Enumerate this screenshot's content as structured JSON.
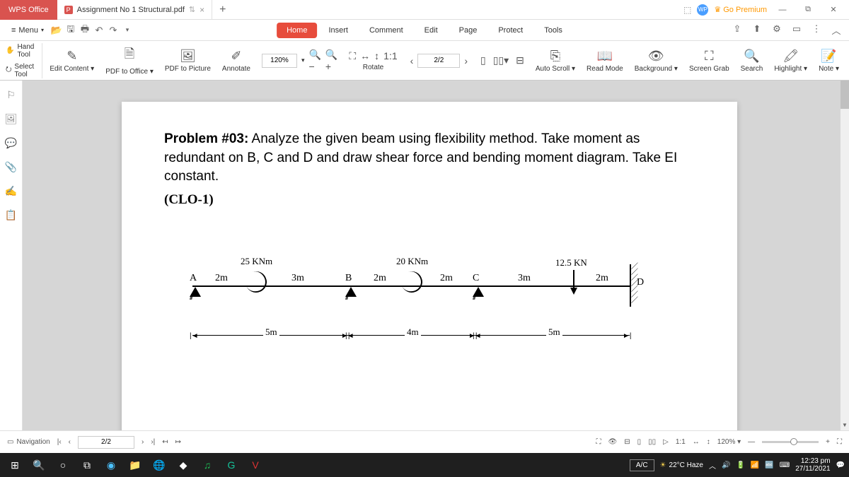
{
  "titlebar": {
    "app_name": "WPS Office",
    "tab_title": "Assignment No 1 Structural.pdf",
    "premium_label": "Go Premium"
  },
  "menubar": {
    "menu_label": "Menu",
    "tabs": {
      "home": "Home",
      "insert": "Insert",
      "comment": "Comment",
      "edit": "Edit",
      "page": "Page",
      "protect": "Protect",
      "tools": "Tools"
    }
  },
  "toolbar": {
    "hand_tool": "Hand Tool",
    "select_tool": "Select Tool",
    "edit_content": "Edit Content",
    "pdf_to_office": "PDF to Office",
    "pdf_to_picture": "PDF to Picture",
    "annotate": "Annotate",
    "zoom_value": "120%",
    "rotate": "Rotate",
    "page_indicator": "2/2",
    "auto_scroll": "Auto Scroll",
    "read_mode": "Read Mode",
    "background": "Background",
    "screen_grab": "Screen Grab",
    "search": "Search",
    "highlight": "Highlight",
    "note": "Note"
  },
  "document": {
    "problem_heading": "Problem #03:",
    "problem_body": " Analyze the given beam using flexibility method. Take moment as redundant on B, C and D and draw shear force and bending moment diagram. Take EI constant.",
    "clo": "(CLO-1)",
    "beam": {
      "moment1": "25 KNm",
      "moment2": "20 KNm",
      "load": "12.5 KN",
      "nodeA": "A",
      "nodeB": "B",
      "nodeC": "C",
      "nodeD": "D",
      "span_ab1": "2m",
      "span_ab2": "3m",
      "span_bc1": "2m",
      "span_bc2": "2m",
      "span_cd1": "3m",
      "span_cd2": "2m",
      "total_ab": "5m",
      "total_bc": "4m",
      "total_cd": "5m"
    }
  },
  "statusbar": {
    "navigation": "Navigation",
    "page": "2/2",
    "zoom_label": "120%"
  },
  "taskbar": {
    "ac": "A/C",
    "weather": "22°C Haze",
    "time": "12:23 pm",
    "date": "27/11/2021"
  }
}
